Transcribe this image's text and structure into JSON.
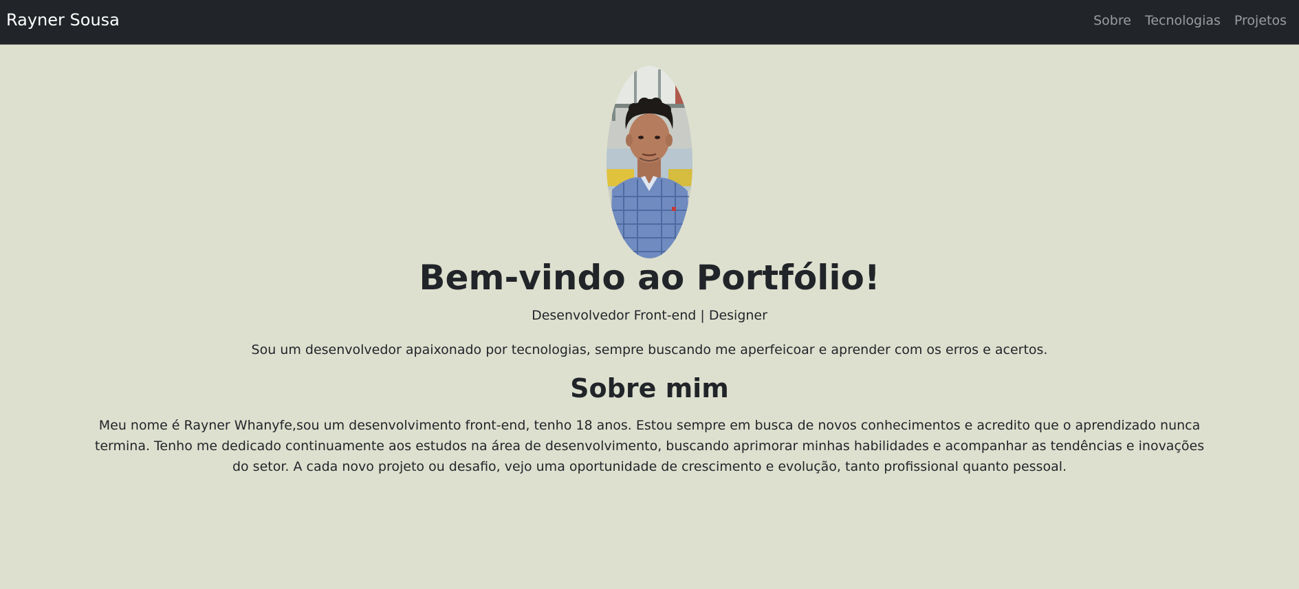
{
  "navbar": {
    "brand": "Rayner Sousa",
    "links": [
      {
        "label": "Sobre"
      },
      {
        "label": "Tecnologias"
      },
      {
        "label": "Projetos"
      }
    ]
  },
  "hero": {
    "avatar_icon": "profile-photo",
    "title": "Bem-vindo ao Portfólio!",
    "subtitle": "Desenvolvedor Front-end | Designer",
    "intro": "Sou um desenvolvedor apaixonado por tecnologias, sempre buscando me aperfeicoar e aprender com os erros e acertos."
  },
  "about": {
    "title": "Sobre mim",
    "text": "Meu nome é Rayner Whanyfe,sou um desenvolvimento front-end, tenho 18 anos. Estou sempre em busca de novos conhecimentos e acredito que o aprendizado nunca termina. Tenho me dedicado continuamente aos estudos na área de desenvolvimento, buscando aprimorar minhas habilidades e acompanhar as tendências e inovações do setor. A cada novo projeto ou desafio, vejo uma oportunidade de crescimento e evolução, tanto profissional quanto pessoal."
  },
  "colors": {
    "page_background": "#dee0cf",
    "navbar_background": "#212529",
    "text": "#212529",
    "nav_link": "#9a9b9d"
  }
}
